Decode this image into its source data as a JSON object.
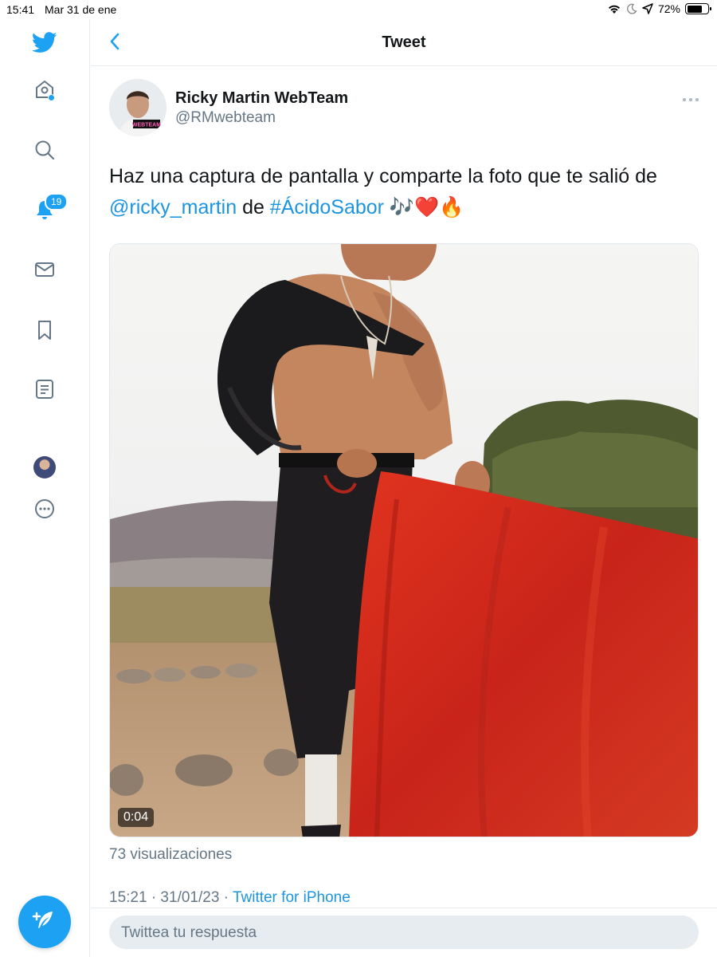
{
  "status_bar": {
    "time": "15:41",
    "date": "Mar 31 de ene",
    "battery": "72%",
    "battery_level": 0.72,
    "icons": [
      "wifi-icon",
      "moon-icon",
      "location-icon",
      "battery-icon"
    ]
  },
  "sidebar": {
    "items": [
      {
        "name": "home",
        "icon": "home-icon"
      },
      {
        "name": "explore",
        "icon": "search-icon"
      },
      {
        "name": "notifications",
        "icon": "bell-icon",
        "badge": "19"
      },
      {
        "name": "messages",
        "icon": "mail-icon"
      },
      {
        "name": "bookmarks",
        "icon": "bookmark-icon"
      },
      {
        "name": "lists",
        "icon": "list-icon"
      },
      {
        "name": "profile",
        "icon": "avatar"
      },
      {
        "name": "more",
        "icon": "more-icon"
      }
    ],
    "compose_icon": "compose-feather-icon"
  },
  "header": {
    "title": "Tweet",
    "back_icon": "chevron-left-icon"
  },
  "tweet": {
    "author_name": "Ricky Martin WebTeam",
    "author_handle": "@RMwebteam",
    "avatar_label": "WEBTEAM",
    "text_before": "Haz una captura de pantalla y comparte la foto que te salió de ",
    "mention": "@ricky_martin",
    "text_middle": " de ",
    "hashtag": "#ÁcidoSabor",
    "emojis": " 🎶❤️🔥",
    "video_duration": "0:04",
    "views": "73 visualizaciones",
    "timestamp": "15:21 · 31/01/23 · ",
    "source": "Twitter for iPhone"
  },
  "reply": {
    "placeholder": "Twittea tu respuesta"
  },
  "colors": {
    "accent": "#1da1f2",
    "link": "#1b95e0",
    "muted": "#657786",
    "cape_red": "#d02a1c"
  }
}
